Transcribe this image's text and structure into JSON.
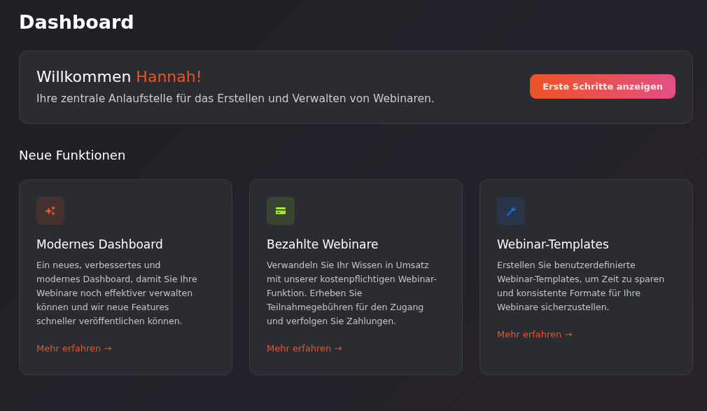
{
  "page": {
    "title": "Dashboard"
  },
  "welcome": {
    "greeting": "Willkommen",
    "name": "Hannah!",
    "subtitle": "Ihre zentrale Anlaufstelle für das Erstellen und Verwalten von Webinaren.",
    "button": "Erste Schritte anzeigen"
  },
  "features": {
    "heading": "Neue Funktionen",
    "cards": [
      {
        "kind": "sparkles",
        "color": "#e8552a",
        "title": "Modernes Dashboard",
        "text": "Ein neues, verbessertes und modernes Dashboard, damit Sie Ihre Webinare noch effektiver verwalten können und wir neue Features schneller veröffentlichen können.",
        "link": "Mehr erfahren →"
      },
      {
        "kind": "card",
        "color": "#a3e635",
        "title": "Bezahlte Webinare",
        "text": "Verwandeln Sie Ihr Wissen in Umsatz mit unserer kostenpflichtigen Webinar-Funktion. Erheben Sie Teilnahmegebühren für den Zugang und verfolgen Sie Zahlungen.",
        "link": "Mehr erfahren →"
      },
      {
        "kind": "wrench",
        "color": "#1d6fe0",
        "title": "Webinar-Templates",
        "text": "Erstellen Sie benutzerdefinierte Webinar-Templates, um Zeit zu sparen und konsistente Formate für Ihre Webinare sicherzustellen.",
        "link": "Mehr erfahren →"
      }
    ]
  }
}
